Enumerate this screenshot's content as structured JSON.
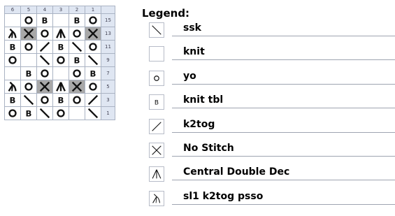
{
  "chart": {
    "columns": [
      "6",
      "5",
      "4",
      "3",
      "2",
      "1"
    ],
    "rows": [
      {
        "label": "15",
        "cells": [
          "",
          "yo",
          "tbl",
          "",
          "tbl",
          "yo"
        ]
      },
      {
        "label": "13",
        "cells": [
          "sl1k2togpsso",
          "nostitch",
          "yo",
          "cdd",
          "yo",
          "nostitch"
        ]
      },
      {
        "label": "11",
        "cells": [
          "tbl",
          "yo",
          "k2tog",
          "tbl",
          "ssk",
          "yo"
        ]
      },
      {
        "label": "9",
        "cells": [
          "yo",
          "",
          "ssk",
          "yo",
          "tbl",
          "ssk"
        ]
      },
      {
        "label": "7",
        "cells": [
          "",
          "tbl",
          "yo",
          "",
          "yo",
          "tbl"
        ]
      },
      {
        "label": "5",
        "cells": [
          "sl1k2togpsso",
          "yo",
          "nostitch",
          "cdd",
          "nostitch",
          "yo"
        ]
      },
      {
        "label": "3",
        "cells": [
          "tbl",
          "ssk",
          "yo",
          "tbl",
          "yo",
          "k2tog"
        ]
      },
      {
        "label": "1",
        "cells": [
          "yo",
          "tbl",
          "ssk",
          "yo",
          "",
          "ssk"
        ]
      }
    ]
  },
  "legend": {
    "title": "Legend:",
    "items": [
      {
        "symbol": "ssk",
        "label": "ssk"
      },
      {
        "symbol": "knit",
        "label": "knit"
      },
      {
        "symbol": "yo",
        "label": "yo"
      },
      {
        "symbol": "tbl",
        "label": "knit tbl"
      },
      {
        "symbol": "k2tog",
        "label": "k2tog"
      },
      {
        "symbol": "nostitch",
        "label": "No Stitch"
      },
      {
        "symbol": "cdd",
        "label": "Central Double Dec"
      },
      {
        "symbol": "sl1k2togpsso",
        "label": "sl1 k2tog psso"
      }
    ]
  }
}
